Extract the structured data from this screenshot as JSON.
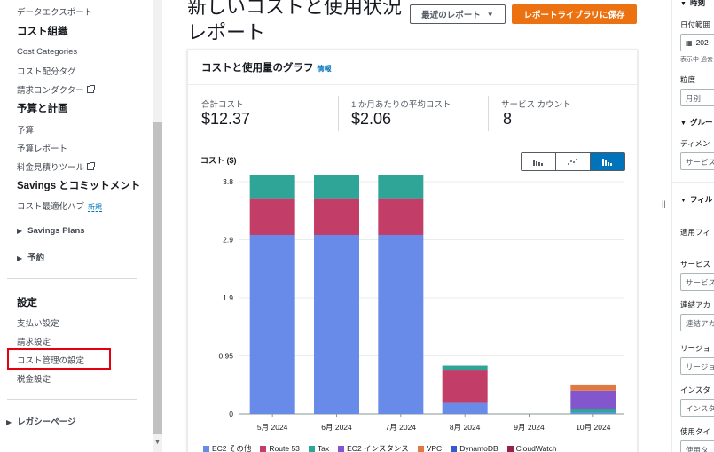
{
  "sidebar": {
    "data_export": "データエクスポート",
    "cost_org_heading": "コスト組織",
    "cost_categories": "Cost Categories",
    "cost_allocation_tags": "コスト配分タグ",
    "billing_conductor": "請求コンダクター",
    "budget_heading": "予算と計画",
    "budgets": "予算",
    "budget_reports": "予算レポート",
    "pricing_calculator": "料金見積りツール",
    "savings_heading": "Savings とコミットメント",
    "cost_optimization_hub": "コスト最適化ハブ",
    "new_badge": "新規",
    "savings_plans": "Savings Plans",
    "reservations": "予約",
    "settings_heading": "設定",
    "payment_settings": "支払い設定",
    "billing_settings": "請求設定",
    "cost_management_settings": "コスト管理の設定",
    "tax_settings": "税金設定",
    "legacy_pages": "レガシーページ"
  },
  "header": {
    "title": "新しいコストと使用状況レポート",
    "recent_reports_button": "最近のレポート",
    "save_button": "レポートライブラリに保存"
  },
  "card": {
    "title": "コストと使用量のグラフ",
    "info": "情報",
    "metrics": [
      {
        "label": "合計コスト",
        "value": "$12.37"
      },
      {
        "label": "1 か月あたりの平均コスト",
        "value": "$2.06"
      },
      {
        "label": "サービス カウント",
        "value": "8"
      }
    ],
    "chart_ylabel": "コスト ($)"
  },
  "chart_data": {
    "type": "bar",
    "stacked": true,
    "ylabel": "コスト ($)",
    "ylim": [
      0,
      3.8
    ],
    "yticks": [
      "0",
      "0.95",
      "1.9",
      "2.9",
      "3.8"
    ],
    "ytick_values": [
      0,
      0.95,
      1.9,
      2.85,
      3.8
    ],
    "categories": [
      "5月 2024",
      "6月 2024",
      "7月 2024",
      "8月 2024",
      "9月 2024",
      "10月 2024"
    ],
    "series": [
      {
        "name": "EC2 その他",
        "color": "#688ae8",
        "values": [
          2.93,
          2.93,
          2.93,
          0.18,
          0,
          0.02
        ]
      },
      {
        "name": "Route 53",
        "color": "#c33d69",
        "values": [
          0.6,
          0.6,
          0.6,
          0.53,
          0,
          0
        ]
      },
      {
        "name": "Tax",
        "color": "#2ea597",
        "values": [
          0.38,
          0.38,
          0.38,
          0.08,
          0,
          0.06
        ]
      },
      {
        "name": "EC2 インスタンス",
        "color": "#8456ce",
        "values": [
          0,
          0,
          0,
          0,
          0,
          0.3
        ]
      },
      {
        "name": "VPC",
        "color": "#e07941",
        "values": [
          0,
          0,
          0,
          0,
          0,
          0.1
        ]
      },
      {
        "name": "DynamoDB",
        "color": "#3759ce",
        "values": [
          0,
          0,
          0,
          0,
          0,
          0
        ]
      },
      {
        "name": "CloudWatch",
        "color": "#962249",
        "values": [
          0,
          0,
          0,
          0,
          0,
          0
        ]
      }
    ],
    "grid": true,
    "legend_position": "bottom"
  },
  "right_panel": {
    "time_heading": "時刻",
    "date_range_label": "日付範囲",
    "date_range_value": "202",
    "timezone_hint": "表示中 過去",
    "granularity_label": "粒度",
    "granularity_value": "月別",
    "group_heading": "グルー",
    "dimension_label": "ディメン",
    "dimension_value": "サービス",
    "filter_heading": "フィル",
    "applied_filters": "適用フィ",
    "service_label": "サービス",
    "service_value": "サービス",
    "linked_account_label": "連結アカ",
    "linked_account_value": "連結アカ",
    "region_label": "リージョ",
    "region_value": "リージョ",
    "instance_label": "インスタ",
    "instance_value": "インスタ",
    "usage_type_label": "使用タイ",
    "usage_type_value": "使用タ"
  }
}
